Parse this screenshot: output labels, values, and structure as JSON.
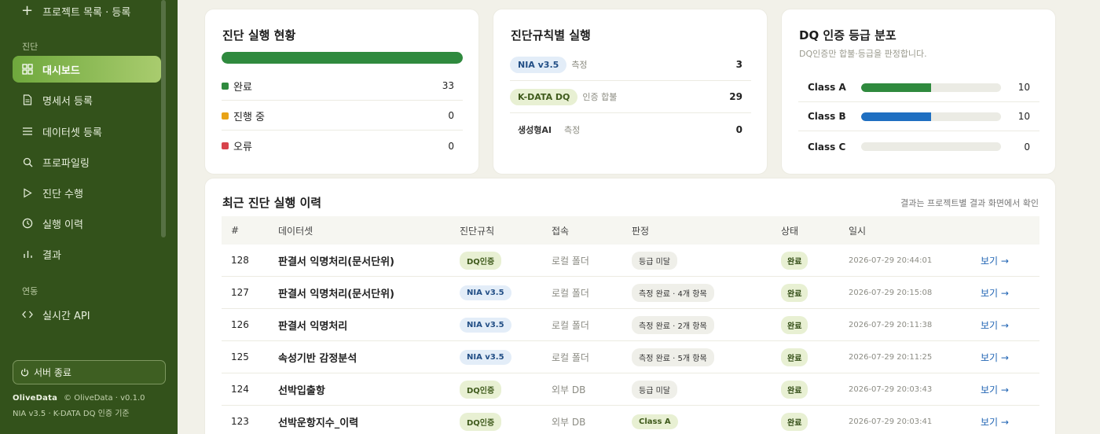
{
  "sidebar": {
    "top_item": "프로젝트 목록 · 등록",
    "section_diag": "진단",
    "items": [
      {
        "label": "대시보드",
        "icon": "grid-icon"
      },
      {
        "label": "명세서 등록",
        "icon": "document-icon"
      },
      {
        "label": "데이터셋 등록",
        "icon": "list-icon"
      },
      {
        "label": "프로파일링",
        "icon": "search-icon"
      },
      {
        "label": "진단 수행",
        "icon": "play-icon"
      },
      {
        "label": "실행 이력",
        "icon": "clock-icon"
      },
      {
        "label": "결과",
        "icon": "bar-chart-icon"
      }
    ],
    "section_link": "연동",
    "api_item": "실시간 API",
    "stop_label": "서버 종료",
    "footer_logo": "OliveData",
    "footer_copy": "© OliveData · v0.1.0",
    "footer_std": "NIA v3.5 · K-DATA DQ 인증 기준"
  },
  "status_card": {
    "title": "진단 실행 현황",
    "progress": 1.0,
    "rows": [
      {
        "label": "완료",
        "value": "33",
        "color": "#2f8a3e"
      },
      {
        "label": "진행 중",
        "value": "0",
        "color": "#e8a317"
      },
      {
        "label": "오류",
        "value": "0",
        "color": "#d8434b"
      }
    ]
  },
  "rule_card": {
    "title": "진단규칙별 실행",
    "rows": [
      {
        "pill": "NIA v3.5",
        "desc": "측정",
        "value": "3"
      },
      {
        "pill": "K-DATA DQ",
        "desc": "인증 합불",
        "value": "29"
      },
      {
        "pill": "생성형AI",
        "desc": "측정",
        "value": "0"
      }
    ]
  },
  "grade_card": {
    "title": "DQ 인증 등급 분포",
    "subtitle": "DQ인증만 합불·등급을 판정합니다.",
    "rows": [
      {
        "label": "Class A",
        "value": "10",
        "fill": 0.5,
        "color": "#2f8a3e"
      },
      {
        "label": "Class B",
        "value": "10",
        "fill": 0.5,
        "color": "#1f6fc1"
      },
      {
        "label": "Class C",
        "value": "0",
        "fill": 0,
        "color": "#2f8a3e"
      }
    ]
  },
  "history": {
    "title": "최근 진단 실행 이력",
    "hint": "결과는 프로젝트별 결과 화면에서 확인",
    "columns": [
      "#",
      "데이터셋",
      "진단규칙",
      "접속",
      "판정",
      "상태",
      "일시"
    ],
    "rows": [
      {
        "id": "128",
        "dataset": "판결서 익명처리(문서단위)",
        "rule": "DQ인증",
        "conn": "로컬 폴더",
        "judge": "등급 미달",
        "state": "완료",
        "date": "2026-07-29 20:44:01",
        "view": "보기 →"
      },
      {
        "id": "127",
        "dataset": "판결서 익명처리(문서단위)",
        "rule": "NIA v3.5",
        "conn": "로컬 폴더",
        "judge": "측정 완료 · 4개 항목",
        "state": "완료",
        "date": "2026-07-29 20:15:08",
        "view": "보기 →"
      },
      {
        "id": "126",
        "dataset": "판결서 익명처리",
        "rule": "NIA v3.5",
        "conn": "로컬 폴더",
        "judge": "측정 완료 · 2개 항목",
        "state": "완료",
        "date": "2026-07-29 20:11:38",
        "view": "보기 →"
      },
      {
        "id": "125",
        "dataset": "속성기반 감정분석",
        "rule": "NIA v3.5",
        "conn": "로컬 폴더",
        "judge": "측정 완료 · 5개 항목",
        "state": "완료",
        "date": "2026-07-29 20:11:25",
        "view": "보기 →"
      },
      {
        "id": "124",
        "dataset": "선박입출항",
        "rule": "DQ인증",
        "conn": "외부 DB",
        "judge": "등급 미달",
        "state": "완료",
        "date": "2026-07-29 20:03:43",
        "view": "보기 →"
      },
      {
        "id": "123",
        "dataset": "선박운항지수_이력",
        "rule": "DQ인증",
        "conn": "외부 DB",
        "judge": "Class A",
        "state": "완료",
        "date": "2026-07-29 20:03:41",
        "view": "보기 →"
      }
    ]
  }
}
